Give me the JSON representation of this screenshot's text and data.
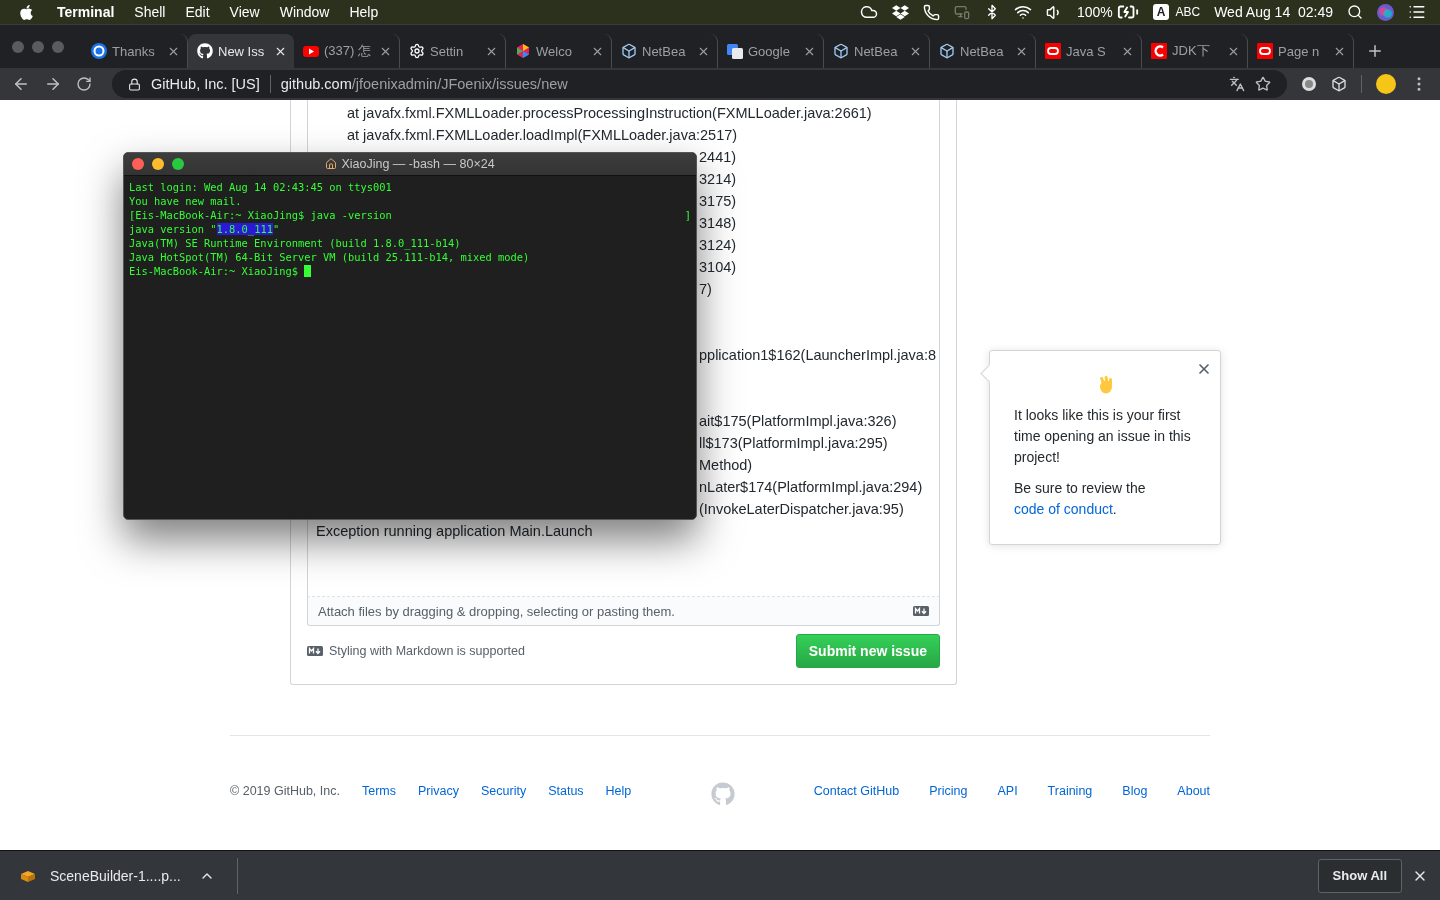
{
  "menu_bar": {
    "app": "Terminal",
    "items": [
      "Shell",
      "Edit",
      "View",
      "Window",
      "Help"
    ],
    "battery": "100%",
    "input_letter": "A",
    "input_name": "ABC",
    "clock": "Wed Aug 14  02:49"
  },
  "tabs": [
    {
      "kind": "google",
      "title": "Thanks",
      "selected": false
    },
    {
      "kind": "github",
      "title": "New Iss",
      "selected": true
    },
    {
      "kind": "youtube",
      "title": "(337) 怎",
      "selected": false
    },
    {
      "kind": "gear",
      "title": "Settin",
      "selected": false
    },
    {
      "kind": "polygon",
      "title": "Welco",
      "selected": false
    },
    {
      "kind": "cube",
      "title": "NetBea",
      "selected": false
    },
    {
      "kind": "translate",
      "title": "Google",
      "selected": false
    },
    {
      "kind": "cube",
      "title": "NetBea",
      "selected": false
    },
    {
      "kind": "cube",
      "title": "NetBea",
      "selected": false
    },
    {
      "kind": "oracle",
      "title": "Java S",
      "selected": false
    },
    {
      "kind": "oracle-c",
      "title": "JDK下",
      "selected": false
    },
    {
      "kind": "oracle",
      "title": "Page n",
      "selected": false
    }
  ],
  "address_bar": {
    "site": "GitHub, Inc. [US]",
    "host": "github.com",
    "path": "/jfoenixadmin/JFoenix/issues/new"
  },
  "trace": [
    {
      "kind": "indented",
      "text": "at javafx.fxml.FXMLLoader.processProcessingInstruction(FXMLLoader.java:2661)"
    },
    {
      "kind": "indented",
      "text": "at javafx.fxml.FXMLLoader.loadImpl(FXMLLoader.java:2517)"
    },
    {
      "kind": "tail",
      "text": "2441)"
    },
    {
      "kind": "tail",
      "text": "3214)"
    },
    {
      "kind": "tail",
      "text": "3175)"
    },
    {
      "kind": "tail",
      "text": "3148)"
    },
    {
      "kind": "tail",
      "text": "3124)"
    },
    {
      "kind": "tail",
      "text": "3104)"
    },
    {
      "kind": "tail",
      "text": "7)"
    },
    {
      "kind": "covered"
    },
    {
      "kind": "covered"
    },
    {
      "kind": "tail",
      "text": "pplication1$162(LauncherImpl.java:8"
    },
    {
      "kind": "covered"
    },
    {
      "kind": "covered"
    },
    {
      "kind": "tail",
      "text": "ait$175(PlatformImpl.java:326)"
    },
    {
      "kind": "tail",
      "text": "ll$173(PlatformImpl.java:295)"
    },
    {
      "kind": "tail",
      "text": "Method)"
    },
    {
      "kind": "tail",
      "text": "nLater$174(PlatformImpl.java:294)"
    },
    {
      "kind": "tail",
      "text": "(InvokeLaterDispatcher.java:95)"
    },
    {
      "kind": "plain",
      "text": "Exception running application Main.Launch"
    }
  ],
  "attach_hint": "Attach files by dragging & dropping, selecting or pasting them.",
  "markdown_note": "Styling with Markdown is supported",
  "submit_button": "Submit new issue",
  "terminal": {
    "title": "XiaoJing — -bash — 80×24",
    "lines": [
      {
        "parts": [
          {
            "text": "Last login: Wed Aug 14 02:43:45 on ttys001",
            "selected": false
          }
        ]
      },
      {
        "parts": [
          {
            "text": "You have new mail.",
            "selected": false
          }
        ]
      },
      {
        "parts": [
          {
            "text": "[Eis-MacBook-Air:~ XiaoJing$ java -version",
            "selected": false
          }
        ],
        "end_mark": "]"
      },
      {
        "parts": [
          {
            "text": "java version \"",
            "selected": false
          },
          {
            "text": "1.8.0_111",
            "selected": true
          },
          {
            "text": "\"",
            "selected": false
          }
        ]
      },
      {
        "parts": [
          {
            "text": "Java(TM) SE Runtime Environment (build 1.8.0_111-b14)",
            "selected": false
          }
        ]
      },
      {
        "parts": [
          {
            "text": "Java HotSpot(TM) 64-Bit Server VM (build 25.111-b14, mixed mode)",
            "selected": false
          }
        ]
      },
      {
        "parts": [
          {
            "text": "Eis-MacBook-Air:~ XiaoJing$ ",
            "selected": false
          }
        ],
        "cursor": true
      }
    ]
  },
  "popover": {
    "message": "It looks like this is your first time opening an issue in this project!",
    "review_text": "Be sure to review the ",
    "link": "code of conduct",
    "end": "."
  },
  "footer": {
    "copyright": "© 2019 GitHub, Inc.",
    "left_links": [
      "Terms",
      "Privacy",
      "Security",
      "Status",
      "Help"
    ],
    "right_links": [
      "Contact GitHub",
      "Pricing",
      "API",
      "Training",
      "Blog",
      "About"
    ]
  },
  "download_bar": {
    "file": "SceneBuilder-1....p...",
    "show_all": "Show All"
  }
}
